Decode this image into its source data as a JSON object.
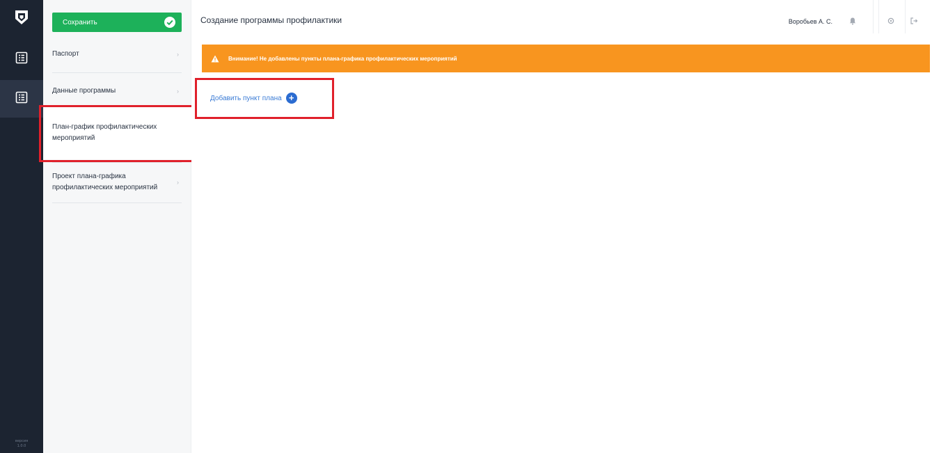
{
  "rail": {
    "logo_icon": "shield-logo-icon",
    "items": [
      {
        "icon": "list-document-icon"
      },
      {
        "icon": "list-document-icon"
      }
    ],
    "version_line1": "версия",
    "version_line2": "1.0.0"
  },
  "sidebar": {
    "save_label": "Сохранить",
    "save_icon": "check-circle-icon",
    "items": [
      {
        "label": "Паспорт",
        "chevron": "›"
      },
      {
        "label": "Данные программы",
        "chevron": "›"
      },
      {
        "label": "План-график профилактических мероприятий",
        "chevron": ""
      },
      {
        "label": "Проект плана-графика профилактических мероприятий",
        "chevron": "›"
      }
    ]
  },
  "header": {
    "title": "Создание программы профилактики",
    "user": "Воробьев А. С.",
    "icons": [
      "bell-icon",
      "gear-icon",
      "exit-icon"
    ]
  },
  "alert": {
    "text": "Внимание! Не добавлены пункты плана-графика профилактических мероприятий",
    "icon": "warning-icon",
    "color": "#f8951f"
  },
  "main": {
    "add_label": "Добавить пункт плана",
    "add_icon": "plus-circle-icon"
  },
  "colors": {
    "rail": "#1c2431",
    "save": "#1db15a",
    "link": "#3a7bd5",
    "highlight": "#e0202b"
  }
}
